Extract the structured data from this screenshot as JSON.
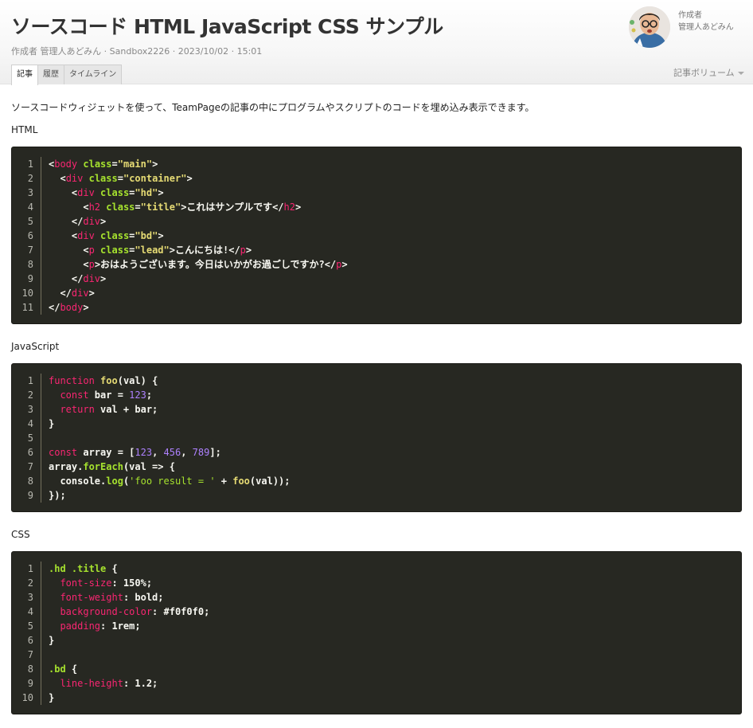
{
  "page": {
    "title": "ソースコード HTML JavaScript CSS サンプル",
    "meta": "作成者 管理人あどみん · Sandbox2226 · 2023/10/02 · 15:01",
    "author_label": "作成者",
    "author_name": "管理人あどみん"
  },
  "tabs": [
    "記事",
    "履歴",
    "タイムライン"
  ],
  "volume_label": "記事ボリューム",
  "intro": "ソースコードウィジェットを使って、TeamPageの記事の中にプログラムやスクリプトのコードを埋め込み表示できます。",
  "sections": [
    {
      "label": "HTML",
      "lines": [
        [
          [
            "p",
            "<"
          ],
          [
            "tag",
            "body"
          ],
          [
            "p",
            " "
          ],
          [
            "attr",
            "class"
          ],
          [
            "p",
            "="
          ],
          [
            "str",
            "\"main\""
          ],
          [
            "p",
            ">"
          ]
        ],
        [
          [
            "p",
            "  <"
          ],
          [
            "tag",
            "div"
          ],
          [
            "p",
            " "
          ],
          [
            "attr",
            "class"
          ],
          [
            "p",
            "="
          ],
          [
            "str",
            "\"container\""
          ],
          [
            "p",
            ">"
          ]
        ],
        [
          [
            "p",
            "    <"
          ],
          [
            "tag",
            "div"
          ],
          [
            "p",
            " "
          ],
          [
            "attr",
            "class"
          ],
          [
            "p",
            "="
          ],
          [
            "str",
            "\"hd\""
          ],
          [
            "p",
            ">"
          ]
        ],
        [
          [
            "p",
            "      <"
          ],
          [
            "tag",
            "h2"
          ],
          [
            "p",
            " "
          ],
          [
            "attr",
            "class"
          ],
          [
            "p",
            "="
          ],
          [
            "str",
            "\"title\""
          ],
          [
            "p",
            ">これはサンプルです</"
          ],
          [
            "tag",
            "h2"
          ],
          [
            "p",
            ">"
          ]
        ],
        [
          [
            "p",
            "    </"
          ],
          [
            "tag",
            "div"
          ],
          [
            "p",
            ">"
          ]
        ],
        [
          [
            "p",
            "    <"
          ],
          [
            "tag",
            "div"
          ],
          [
            "p",
            " "
          ],
          [
            "attr",
            "class"
          ],
          [
            "p",
            "="
          ],
          [
            "str",
            "\"bd\""
          ],
          [
            "p",
            ">"
          ]
        ],
        [
          [
            "p",
            "      <"
          ],
          [
            "tag",
            "p"
          ],
          [
            "p",
            " "
          ],
          [
            "attr",
            "class"
          ],
          [
            "p",
            "="
          ],
          [
            "str",
            "\"lead\""
          ],
          [
            "p",
            ">こんにちは!</"
          ],
          [
            "tag",
            "p"
          ],
          [
            "p",
            ">"
          ]
        ],
        [
          [
            "p",
            "      <"
          ],
          [
            "tag",
            "p"
          ],
          [
            "p",
            ">おはようございます。今日はいかがお過ごしですか?</"
          ],
          [
            "tag",
            "p"
          ],
          [
            "p",
            ">"
          ]
        ],
        [
          [
            "p",
            "    </"
          ],
          [
            "tag",
            "div"
          ],
          [
            "p",
            ">"
          ]
        ],
        [
          [
            "p",
            "  </"
          ],
          [
            "tag",
            "div"
          ],
          [
            "p",
            ">"
          ]
        ],
        [
          [
            "p",
            "</"
          ],
          [
            "tag",
            "body"
          ],
          [
            "p",
            ">"
          ]
        ]
      ]
    },
    {
      "label": "JavaScript",
      "lines": [
        [
          [
            "kw",
            "function"
          ],
          [
            "p",
            " "
          ],
          [
            "fn",
            "foo"
          ],
          [
            "p",
            "(val) {"
          ]
        ],
        [
          [
            "p",
            "  "
          ],
          [
            "kw",
            "const"
          ],
          [
            "p",
            " bar = "
          ],
          [
            "num",
            "123"
          ],
          [
            "p",
            ";"
          ]
        ],
        [
          [
            "p",
            "  "
          ],
          [
            "kw",
            "return"
          ],
          [
            "p",
            " val + bar;"
          ]
        ],
        [
          [
            "p",
            "}"
          ]
        ],
        [
          [
            "p",
            ""
          ]
        ],
        [
          [
            "kw",
            "const"
          ],
          [
            "p",
            " array = ["
          ],
          [
            "num",
            "123"
          ],
          [
            "p",
            ", "
          ],
          [
            "num",
            "456"
          ],
          [
            "p",
            ", "
          ],
          [
            "num",
            "789"
          ],
          [
            "p",
            "];"
          ]
        ],
        [
          [
            "p",
            "array."
          ],
          [
            "sel",
            "forEach"
          ],
          [
            "p",
            "(val => {"
          ]
        ],
        [
          [
            "p",
            "  console."
          ],
          [
            "sel",
            "log"
          ],
          [
            "p",
            "("
          ],
          [
            "strg",
            "'foo result = '"
          ],
          [
            "p",
            " + "
          ],
          [
            "fn",
            "foo"
          ],
          [
            "p",
            "(val));"
          ]
        ],
        [
          [
            "p",
            "});"
          ]
        ]
      ]
    },
    {
      "label": "CSS",
      "lines": [
        [
          [
            "sel",
            ".hd .title"
          ],
          [
            "p",
            " {"
          ]
        ],
        [
          [
            "p",
            "  "
          ],
          [
            "prop",
            "font-size"
          ],
          [
            "p",
            ": 150%;"
          ]
        ],
        [
          [
            "p",
            "  "
          ],
          [
            "prop",
            "font-weight"
          ],
          [
            "p",
            ": bold;"
          ]
        ],
        [
          [
            "p",
            "  "
          ],
          [
            "prop",
            "background-color"
          ],
          [
            "p",
            ": #f0f0f0;"
          ]
        ],
        [
          [
            "p",
            "  "
          ],
          [
            "prop",
            "padding"
          ],
          [
            "p",
            ": 1rem;"
          ]
        ],
        [
          [
            "p",
            "}"
          ]
        ],
        [
          [
            "p",
            ""
          ]
        ],
        [
          [
            "sel",
            ".bd"
          ],
          [
            "p",
            " {"
          ]
        ],
        [
          [
            "p",
            "  "
          ],
          [
            "prop",
            "line-height"
          ],
          [
            "p",
            ": 1.2;"
          ]
        ],
        [
          [
            "p",
            "}"
          ]
        ]
      ]
    }
  ]
}
